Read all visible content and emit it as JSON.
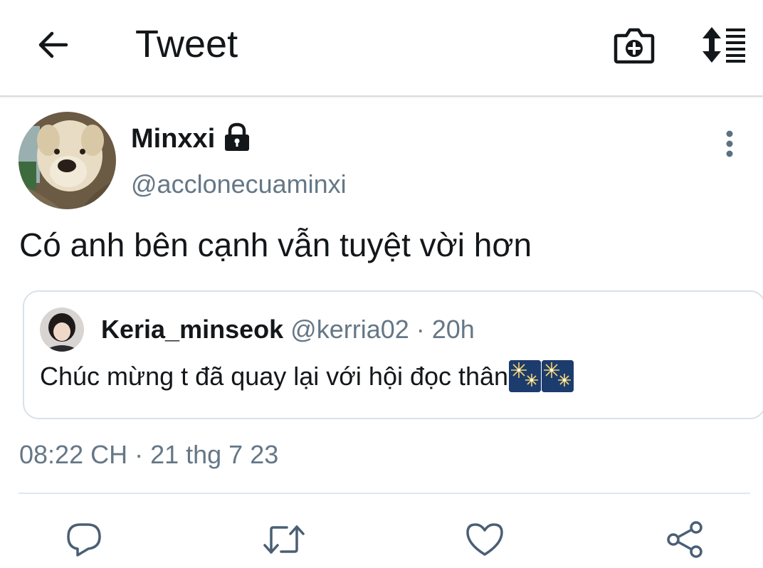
{
  "header": {
    "title": "Tweet",
    "back_icon": "arrow-left-icon",
    "camera_icon": "camera-plus-icon",
    "sort_icon": "sort-list-icon"
  },
  "tweet": {
    "author_name": "Minxxi",
    "author_handle": "@acclonecuaminxi",
    "protected_icon": "lock-icon",
    "text": "Có anh bên cạnh vẫn tuyệt vời hơn",
    "timestamp": "08:22 CH · 21 thg 7 23"
  },
  "quoted_tweet": {
    "author_name": "Keria_minseok",
    "author_handle": "@kerria02",
    "separator": " · ",
    "time_ago": "20h",
    "text": "Chúc mừng t đã quay lại với hội đọc thân",
    "emoji": [
      "fireworks-icon",
      "fireworks-icon"
    ]
  },
  "actions": [
    {
      "icon": "reply-icon"
    },
    {
      "icon": "retweet-icon"
    },
    {
      "icon": "like-icon"
    },
    {
      "icon": "share-icon"
    }
  ],
  "colors": {
    "text_primary": "#14171a",
    "text_secondary": "#657786",
    "icon": "#4a5f75",
    "border": "#d9e1e8"
  }
}
